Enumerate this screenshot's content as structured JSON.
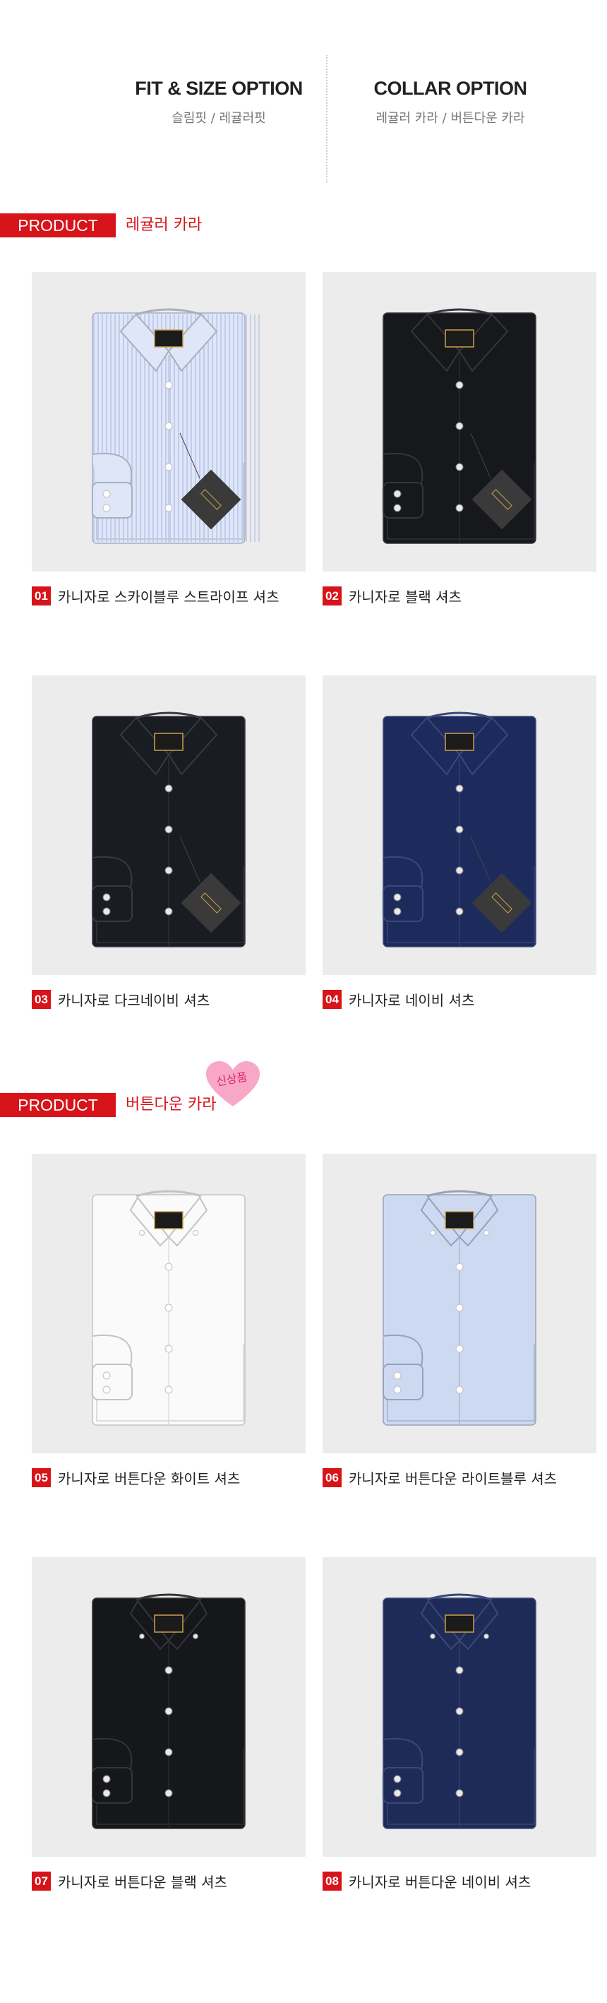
{
  "options": {
    "fit": {
      "title": "FIT & SIZE OPTION",
      "subtitle": "슬림핏 / 레귤러핏"
    },
    "collar": {
      "title": "COLLAR OPTION",
      "subtitle": "레귤러 카라 / 버튼다운 카라"
    }
  },
  "sections": [
    {
      "tag": "PRODUCT",
      "name": "레귤러 카라"
    },
    {
      "tag": "PRODUCT",
      "name": "버튼다운 카라",
      "badge": "신상품"
    }
  ],
  "products": [
    {
      "num": "01",
      "name": "카니자로 스카이블루 스트라이프 셔츠",
      "color": "#dfe6f7",
      "style": "regular-stripe"
    },
    {
      "num": "02",
      "name": "카니자로 블랙 셔츠",
      "color": "#16181c",
      "style": "regular"
    },
    {
      "num": "03",
      "name": "카니자로 다크네이비 셔츠",
      "color": "#1a1c24",
      "style": "regular"
    },
    {
      "num": "04",
      "name": "카니자로 네이비 셔츠",
      "color": "#1d2a5c",
      "style": "regular"
    },
    {
      "num": "05",
      "name": "카니자로 버튼다운 화이트 셔츠",
      "color": "#fafafa",
      "style": "buttondown"
    },
    {
      "num": "06",
      "name": "카니자로 버튼다운 라이트블루 셔츠",
      "color": "#cdd9f0",
      "style": "buttondown"
    },
    {
      "num": "07",
      "name": "카니자로 버튼다운 블랙 셔츠",
      "color": "#15171b",
      "style": "buttondown"
    },
    {
      "num": "08",
      "name": "카니자로 버튼다운 네이비 셔츠",
      "color": "#1e2b58",
      "style": "buttondown"
    }
  ]
}
